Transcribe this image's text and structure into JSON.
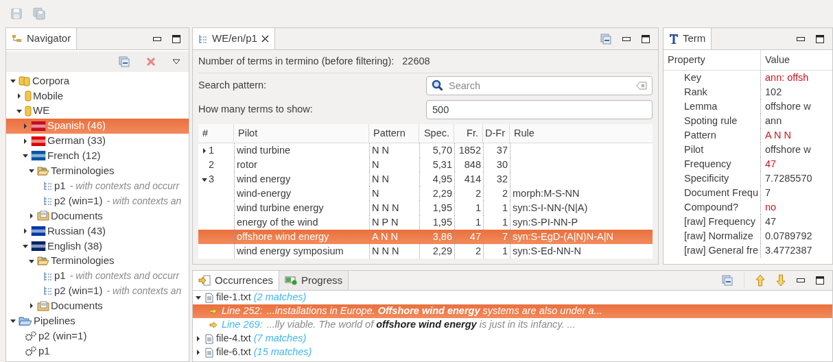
{
  "navigator": {
    "tab": {
      "label": "Navigator",
      "selected": true
    },
    "tree": [
      {
        "label": "Corpora",
        "kind": "corpora",
        "expanded": true,
        "selected": false,
        "children": [
          {
            "label": "Mobile",
            "kind": "corpus",
            "expanded": false,
            "selected": false
          },
          {
            "label": "WE",
            "kind": "corpus",
            "expanded": true,
            "selected": false,
            "children": [
              {
                "label": "Spanish (46)",
                "kind": "language",
                "color": "#c60b1e",
                "expanded": false,
                "selected": true
              },
              {
                "label": "German (33)",
                "kind": "language",
                "color": "#dd0000",
                "expanded": false,
                "selected": false
              },
              {
                "label": "French (12)",
                "kind": "language",
                "color": "#0055a4",
                "expanded": true,
                "selected": false,
                "children": [
                  {
                    "label": "Terminologies",
                    "kind": "folder",
                    "expanded": true,
                    "selected": false,
                    "children": [
                      {
                        "label": "p1",
                        "note": "- with contexts and occurr",
                        "kind": "termino",
                        "selected": false
                      },
                      {
                        "label": "p2 (win=1)",
                        "note": "- with contexts an",
                        "kind": "termino",
                        "selected": false
                      }
                    ]
                  },
                  {
                    "label": "Documents",
                    "kind": "documents",
                    "expanded": false,
                    "selected": false
                  }
                ]
              },
              {
                "label": "Russian (43)",
                "kind": "language",
                "color": "#0039a6",
                "expanded": false,
                "selected": false
              },
              {
                "label": "English (38)",
                "kind": "language",
                "color": "#012169",
                "expanded": true,
                "selected": false,
                "children": [
                  {
                    "label": "Terminologies",
                    "kind": "folder",
                    "expanded": true,
                    "selected": false,
                    "children": [
                      {
                        "label": "p1",
                        "note": "- with contexts and occurr",
                        "kind": "termino",
                        "selected": false
                      },
                      {
                        "label": "p2 (win=1)",
                        "note": "- with contexts an",
                        "kind": "termino",
                        "selected": false
                      }
                    ]
                  },
                  {
                    "label": "Documents",
                    "kind": "documents",
                    "expanded": false,
                    "selected": false
                  }
                ]
              }
            ]
          }
        ]
      },
      {
        "label": "Pipelines",
        "kind": "pipelines",
        "expanded": true,
        "selected": false,
        "children": [
          {
            "label": "p2 (win=1)",
            "kind": "pipeline",
            "selected": false
          },
          {
            "label": "p1",
            "kind": "pipeline",
            "selected": false
          }
        ]
      }
    ]
  },
  "editor": {
    "tab": {
      "label": "WE/en/p1",
      "selected": true
    },
    "count_label": "Number of terms in termino (before filtering):",
    "count_value": "22608",
    "search_label": "Search pattern:",
    "search": {
      "placeholder": "Search"
    },
    "limit_label": "How many terms to show:",
    "limit": {
      "value": "500"
    },
    "table": {
      "columns": [
        "#",
        "Pilot",
        "Pattern",
        "Spec.",
        "Fr.",
        "D-Fr",
        "Rule"
      ],
      "rows": [
        {
          "num": "1",
          "expanded": false,
          "pilot": "wind turbine",
          "pattern": "N N",
          "spec": "5,70",
          "fr": "1852",
          "dfr": "37",
          "selected": false
        },
        {
          "num": "2",
          "pilot": "rotor",
          "pattern": "N",
          "spec": "5,31",
          "fr": "848",
          "dfr": "30",
          "selected": false
        },
        {
          "num": "3",
          "expanded": true,
          "pilot": "wind energy",
          "pattern": "N N",
          "spec": "4,95",
          "fr": "414",
          "dfr": "32",
          "selected": false
        },
        {
          "pilot": "wind-energy",
          "pattern": "N",
          "spec": "2,29",
          "fr": "2",
          "dfr": "2",
          "rule": "morph:M-S-NN",
          "selected": false
        },
        {
          "pilot": "wind turbine energy",
          "pattern": "N N N",
          "spec": "1,95",
          "fr": "1",
          "dfr": "1",
          "rule": "syn:S-I-NN-(N|A)",
          "selected": false
        },
        {
          "pilot": "energy of the wind",
          "pattern": "N P N",
          "spec": "1,95",
          "fr": "1",
          "dfr": "1",
          "rule": "syn:S-PI-NN-P",
          "selected": false
        },
        {
          "pilot": "offshore wind energy",
          "pattern": "A N N",
          "spec": "3,86",
          "fr": "47",
          "dfr": "7",
          "rule": "syn:S-EgD-(A|N)N-A|N",
          "selected": true
        },
        {
          "pilot": "wind energy symposium",
          "pattern": "N N N",
          "spec": "2,29",
          "fr": "2",
          "dfr": "1",
          "rule": "syn:S-Ed-NN-N",
          "selected": false
        }
      ]
    }
  },
  "term": {
    "tab": {
      "label": "Term",
      "selected": true
    },
    "columns": [
      "Property",
      "Value"
    ],
    "rows": [
      {
        "property": "Key",
        "value": "ann: offsh",
        "highlight": true
      },
      {
        "property": "Rank",
        "value": "102",
        "highlight": false
      },
      {
        "property": "Lemma",
        "value": "offshore w",
        "highlight": false
      },
      {
        "property": "Spoting rule",
        "value": "ann",
        "highlight": false
      },
      {
        "property": "Pattern",
        "value": "A N N",
        "highlight": true
      },
      {
        "property": "Pilot",
        "value": "offshore w",
        "highlight": false
      },
      {
        "property": "Frequency",
        "value": "47",
        "highlight": true
      },
      {
        "property": "Specificity",
        "value": "7.7285570",
        "highlight": false
      },
      {
        "property": "Document Frequ",
        "value": "7",
        "highlight": false
      },
      {
        "property": "Compound?",
        "value": "no",
        "highlight": true
      },
      {
        "property": "[raw] Frequency",
        "value": "47",
        "highlight": false
      },
      {
        "property": "[raw] Normalize",
        "value": "0.0789792",
        "highlight": false
      },
      {
        "property": "[raw] General fre",
        "value": "3.4772387",
        "highlight": false
      }
    ]
  },
  "bottom": {
    "tabs": [
      {
        "label": "Occurrences",
        "kind": "occurrences",
        "selected": true
      },
      {
        "label": "Progress",
        "kind": "progress",
        "selected": false
      }
    ],
    "files": [
      {
        "name": "file-1.txt",
        "count": "(2 matches)",
        "expanded": true,
        "children": [
          {
            "line": "Line 252:",
            "text": "...installations in Europe. **Offshore wind energy** systems are also under a...",
            "selected": true
          },
          {
            "line": "Line 269:",
            "text": "...lly viable. The world of **offshore wind energy** is just in its infancy. ...",
            "selected": false
          }
        ]
      },
      {
        "name": "file-4.txt",
        "count": "(7 matches)",
        "expanded": false
      },
      {
        "name": "file-6.txt",
        "count": "(15 matches)",
        "expanded": false
      }
    ]
  }
}
